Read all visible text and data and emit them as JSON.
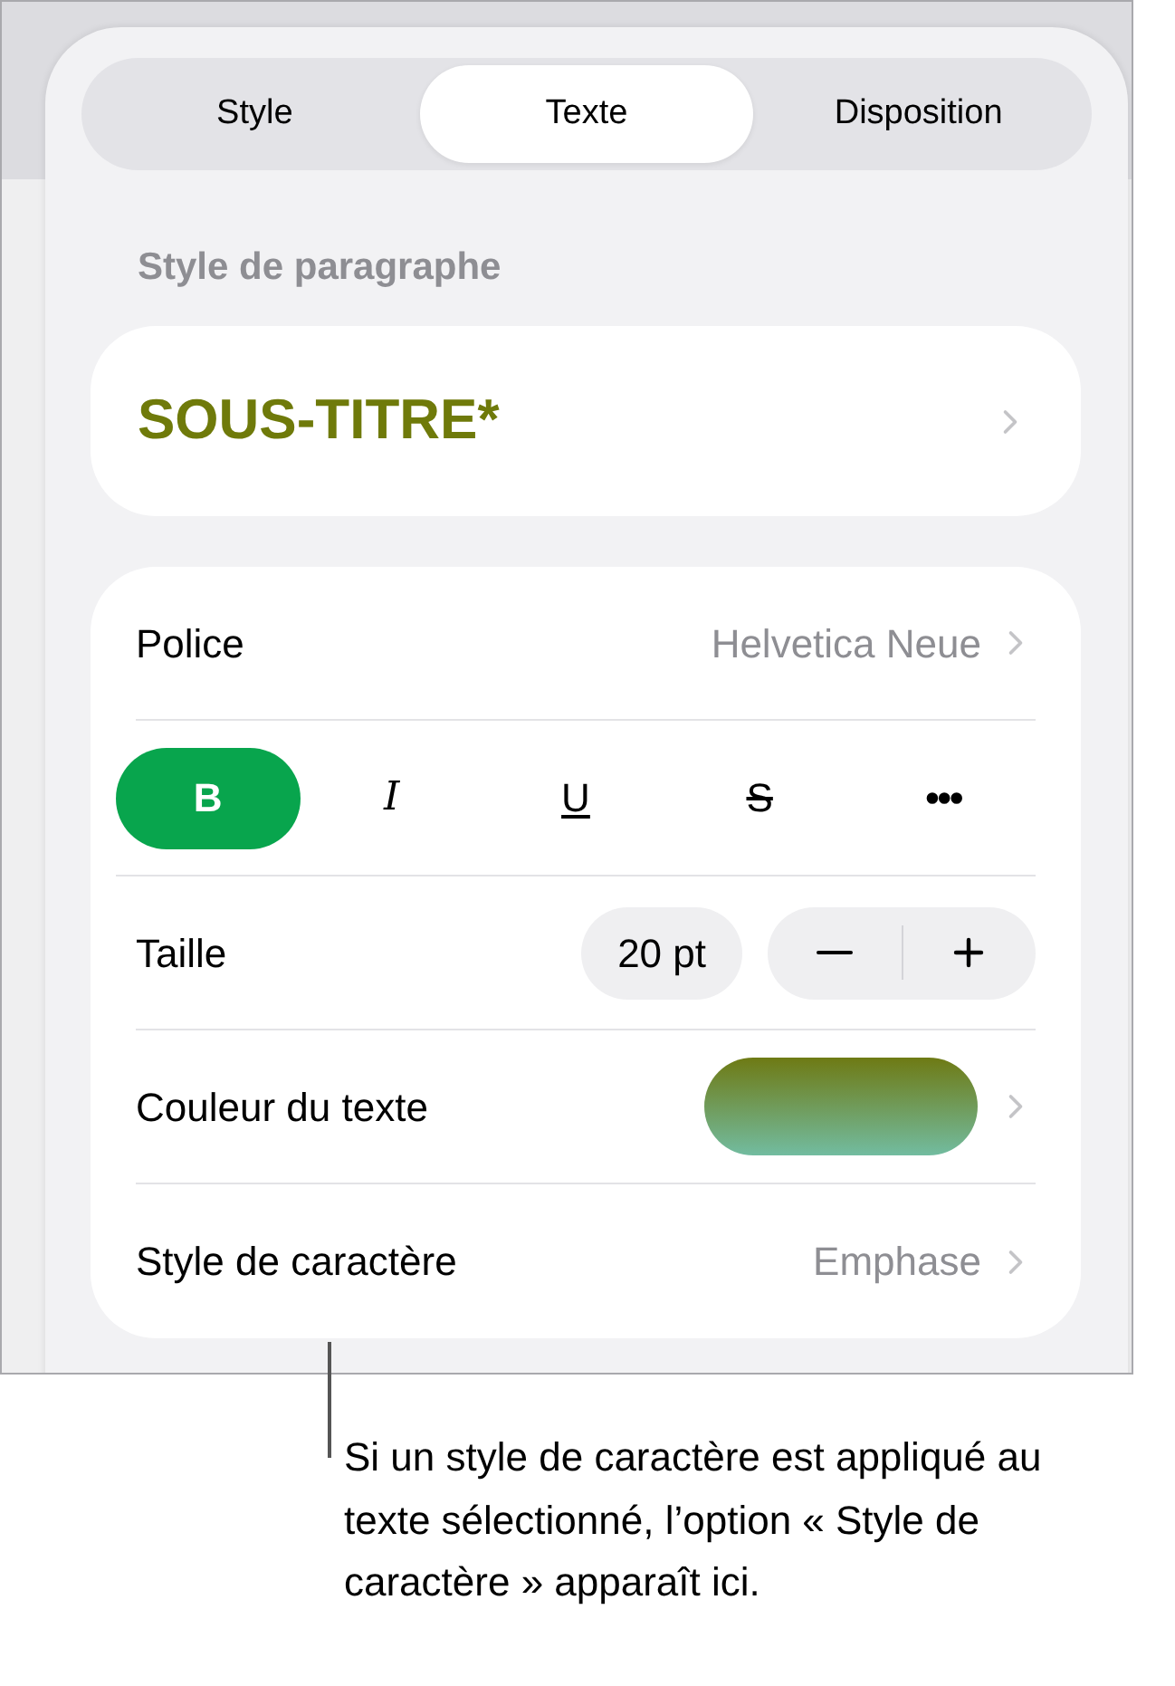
{
  "tabs": [
    {
      "label": "Style",
      "selected": false
    },
    {
      "label": "Texte",
      "selected": true
    },
    {
      "label": "Disposition",
      "selected": false
    }
  ],
  "paragraph_style": {
    "heading": "Style de paragraphe",
    "value": "SOUS-TITRE*"
  },
  "font": {
    "label": "Police",
    "value": "Helvetica Neue"
  },
  "format_buttons": [
    {
      "kind": "bold",
      "label": "B",
      "selected": true
    },
    {
      "kind": "italic",
      "label": "I",
      "selected": false
    },
    {
      "kind": "underline",
      "label": "U",
      "selected": false
    },
    {
      "kind": "strike",
      "label": "S",
      "selected": false
    },
    {
      "kind": "more",
      "label": "•••",
      "selected": false
    }
  ],
  "size": {
    "label": "Taille",
    "value": "20 pt"
  },
  "text_color": {
    "label": "Couleur du texte"
  },
  "character_style": {
    "label": "Style de caractère",
    "value": "Emphase"
  },
  "callout": "Si un style de caractère est appliqué au texte sélectionné, l’option « Style de caractère » apparaît ici."
}
